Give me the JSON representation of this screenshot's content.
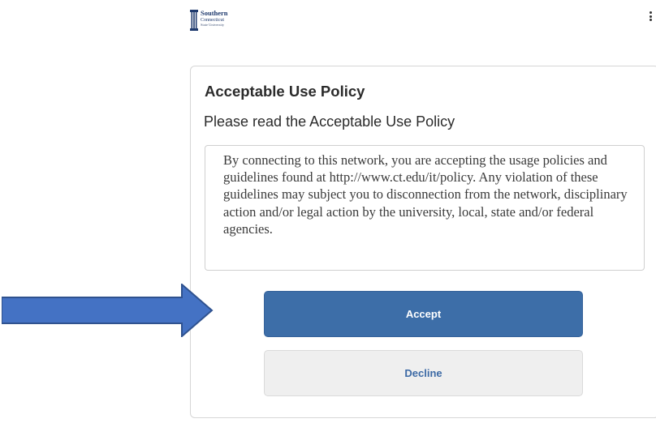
{
  "branding": {
    "logo_line1": "Southern",
    "logo_line2": "Connecticut",
    "logo_line3": "State University"
  },
  "header": {
    "menu_icon": "vertical-ellipsis-icon"
  },
  "card": {
    "title": "Acceptable Use Policy",
    "subtitle": "Please read the Acceptable Use Policy",
    "policy_text": "By connecting to this network, you are accepting the usage policies and guidelines found at http://www.ct.edu/it/policy. Any violation of these guidelines may subject you to disconnection from the network, disciplinary action and/or legal action by the university, local, state and/or federal agencies."
  },
  "actions": {
    "accept_label": "Accept",
    "decline_label": "Decline"
  },
  "annotation": {
    "arrow_icon": "right-arrow-icon",
    "arrow_color": "#4472c4"
  },
  "colors": {
    "accept_bg": "#3d6ea8",
    "decline_text": "#3d6aa5",
    "brand_navy": "#1f3a6e"
  }
}
